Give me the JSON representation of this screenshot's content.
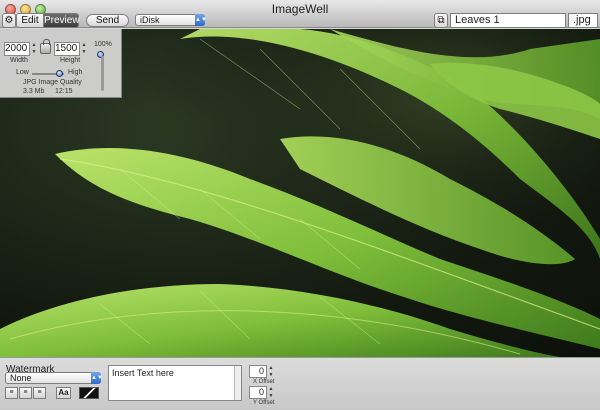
{
  "window": {
    "title": "ImageWell"
  },
  "toolbar": {
    "edit_label": "Edit",
    "preview_label": "Preview",
    "send_label": "Send",
    "destination": "iDisk",
    "filename": "Leaves 1",
    "extension": ".jpg"
  },
  "hud": {
    "width_value": "2000",
    "height_value": "1500",
    "width_label": "Width",
    "height_label": "Height",
    "quality_low_label": "Low",
    "quality_high_label": "High",
    "quality_caption": "JPG Image Quality",
    "file_size": "3.3 Mb",
    "time": "12:15",
    "zoom": "100%"
  },
  "watermark": {
    "label": "Watermark",
    "selection": "None",
    "text_placeholder": "Insert Text here",
    "x_offset_value": "0",
    "y_offset_value": "0",
    "x_offset_label": "X Offset",
    "y_offset_label": "Y Offset"
  },
  "colors": {
    "leaf": "#7fbf3a",
    "leaf_highlight": "#b9e36a",
    "background_dark": "#141a10",
    "accent_blue": "#2d6cc9"
  }
}
